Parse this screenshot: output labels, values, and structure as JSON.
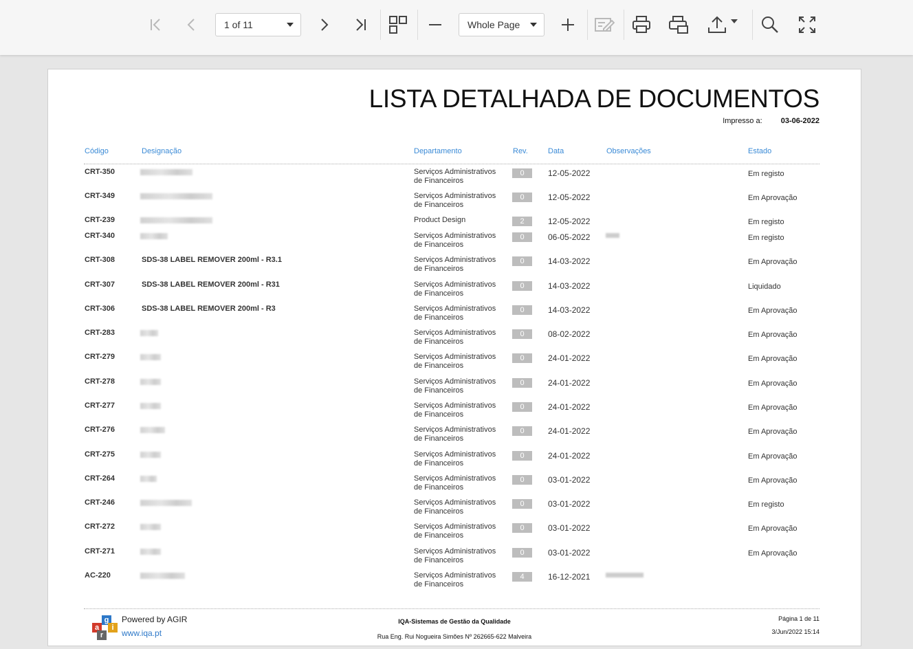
{
  "toolbar": {
    "page_select": "1 of 11",
    "zoom_select": "Whole Page"
  },
  "report": {
    "title": "LISTA DETALHADA DE DOCUMENTOS",
    "printed_label": "Impresso a:",
    "printed_date": "03-06-2022",
    "headers": {
      "code": "Código",
      "designation": "Designação",
      "department": "Departamento",
      "rev": "Rev.",
      "date": "Data",
      "observations": "Observações",
      "state": "Estado"
    },
    "rows": [
      {
        "code": "CRT-350",
        "designation": "",
        "dept": [
          "Serviços Administrativos",
          "de Financeiros"
        ],
        "rev": "0",
        "date": "12-05-2022",
        "state": "Em registo"
      },
      {
        "code": "CRT-349",
        "designation": "",
        "dept": [
          "Serviços Administrativos",
          "de Financeiros"
        ],
        "rev": "0",
        "date": "12-05-2022",
        "state": "Em Aprovação"
      },
      {
        "code": "CRT-239",
        "designation": "",
        "dept": [
          "Product Design",
          ""
        ],
        "rev": "2",
        "date": "12-05-2022",
        "state": "Em registo"
      },
      {
        "code": "CRT-340",
        "designation": "",
        "dept": [
          "Serviços Administrativos",
          "de Financeiros"
        ],
        "rev": "0",
        "date": "06-05-2022",
        "state": "Em registo"
      },
      {
        "code": "CRT-308",
        "designation": "SDS-38 LABEL REMOVER 200ml - R3.1",
        "dept": [
          "Serviços Administrativos",
          "de Financeiros"
        ],
        "rev": "0",
        "date": "14-03-2022",
        "state": "Em Aprovação"
      },
      {
        "code": "CRT-307",
        "designation": "SDS-38 LABEL REMOVER 200ml - R31",
        "dept": [
          "Serviços Administrativos",
          "de Financeiros"
        ],
        "rev": "0",
        "date": "14-03-2022",
        "state": "Liquidado"
      },
      {
        "code": "CRT-306",
        "designation": "SDS-38 LABEL REMOVER 200ml - R3",
        "dept": [
          "Serviços Administrativos",
          "de Financeiros"
        ],
        "rev": "0",
        "date": "14-03-2022",
        "state": "Em Aprovação"
      },
      {
        "code": "CRT-283",
        "designation": "",
        "dept": [
          "Serviços Administrativos",
          "de Financeiros"
        ],
        "rev": "0",
        "date": "08-02-2022",
        "state": "Em Aprovação"
      },
      {
        "code": "CRT-279",
        "designation": "",
        "dept": [
          "Serviços Administrativos",
          "de Financeiros"
        ],
        "rev": "0",
        "date": "24-01-2022",
        "state": "Em Aprovação"
      },
      {
        "code": "CRT-278",
        "designation": "",
        "dept": [
          "Serviços Administrativos",
          "de Financeiros"
        ],
        "rev": "0",
        "date": "24-01-2022",
        "state": "Em Aprovação"
      },
      {
        "code": "CRT-277",
        "designation": "",
        "dept": [
          "Serviços Administrativos",
          "de Financeiros"
        ],
        "rev": "0",
        "date": "24-01-2022",
        "state": "Em Aprovação"
      },
      {
        "code": "CRT-276",
        "designation": "",
        "dept": [
          "Serviços Administrativos",
          "de Financeiros"
        ],
        "rev": "0",
        "date": "24-01-2022",
        "state": "Em Aprovação"
      },
      {
        "code": "CRT-275",
        "designation": "",
        "dept": [
          "Serviços Administrativos",
          "de Financeiros"
        ],
        "rev": "0",
        "date": "24-01-2022",
        "state": "Em Aprovação"
      },
      {
        "code": "CRT-264",
        "designation": "",
        "dept": [
          "Serviços Administrativos",
          "de Financeiros"
        ],
        "rev": "0",
        "date": "03-01-2022",
        "state": "Em Aprovação"
      },
      {
        "code": "CRT-246",
        "designation": "",
        "dept": [
          "Serviços Administrativos",
          "de Financeiros"
        ],
        "rev": "0",
        "date": "03-01-2022",
        "state": "Em registo"
      },
      {
        "code": "CRT-272",
        "designation": "",
        "dept": [
          "Serviços Administrativos",
          "de Financeiros"
        ],
        "rev": "0",
        "date": "03-01-2022",
        "state": "Em Aprovação"
      },
      {
        "code": "CRT-271",
        "designation": "",
        "dept": [
          "Serviços Administrativos",
          "de Financeiros"
        ],
        "rev": "0",
        "date": "03-01-2022",
        "state": "Em Aprovação"
      },
      {
        "code": "AC-220",
        "designation": "",
        "dept": [
          "Serviços Administrativos",
          "de Financeiros"
        ],
        "rev": "4",
        "date": "16-12-2021",
        "state": ""
      }
    ]
  },
  "footer": {
    "powered": "Powered by AGIR",
    "site": "www.iqa.pt",
    "company": "IQA-Sistemas de Gestão da Qualidade",
    "address": "Rua Eng. Rui Nogueira Simões Nº 262665-622 Malveira",
    "page_info": "Página 1 de 11",
    "timestamp": "3/Jun/2022 15:14",
    "logo_letters": [
      "g",
      "a",
      "i",
      "r"
    ]
  }
}
